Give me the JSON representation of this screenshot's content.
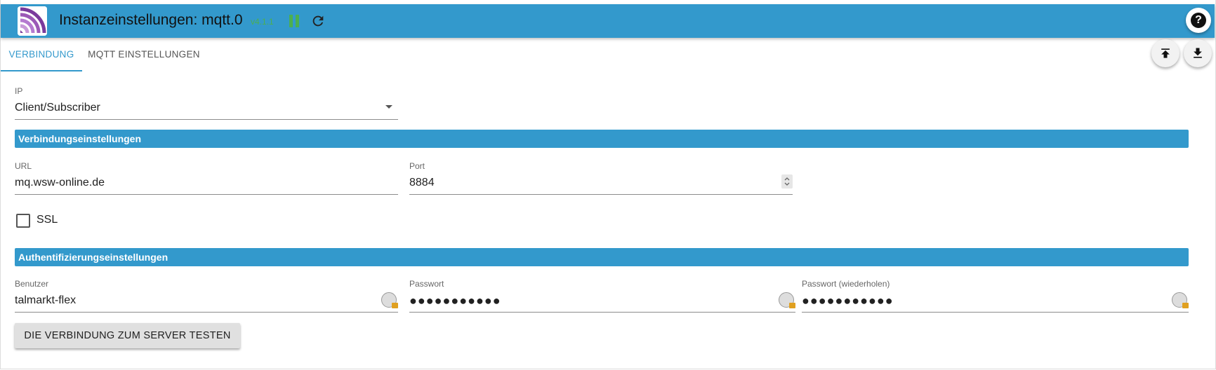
{
  "header": {
    "title": "Instanzeinstellungen: mqtt.0",
    "version": "v4.1.1",
    "help_label": "?",
    "pause_icon": "pause-icon",
    "reload_icon": "reload-icon",
    "accent": "#3399cc",
    "status_color": "#4caf50"
  },
  "tabs": [
    {
      "label": "VERBINDUNG",
      "active": true
    },
    {
      "label": "MQTT EINSTELLUNGEN",
      "active": false
    }
  ],
  "actions": {
    "upload_icon": "upload-icon",
    "download_icon": "download-icon"
  },
  "form": {
    "ip": {
      "label": "IP",
      "value": "Client/Subscriber"
    },
    "section_connection": "Verbindungseinstellungen",
    "url": {
      "label": "URL",
      "value": "mq.wsw-online.de"
    },
    "port": {
      "label": "Port",
      "value": "8884"
    },
    "ssl": {
      "label": "SSL",
      "checked": false
    },
    "section_auth": "Authentifizierungseinstellungen",
    "user": {
      "label": "Benutzer",
      "value": "talmarkt-flex"
    },
    "password": {
      "label": "Passwort",
      "value": "●●●●●●●●●●●"
    },
    "password_repeat": {
      "label": "Passwort (wiederholen)",
      "value": "●●●●●●●●●●●"
    },
    "test_button": "DIE VERBINDUNG ZUM SERVER TESTEN"
  }
}
